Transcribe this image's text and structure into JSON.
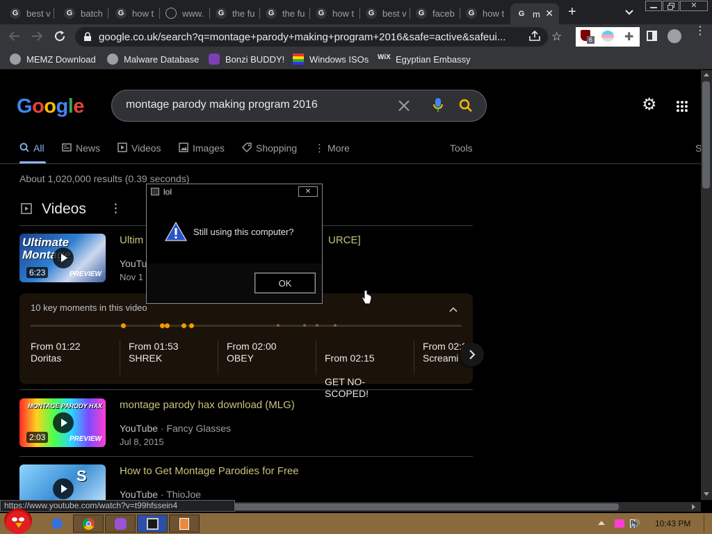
{
  "browser": {
    "tabs": [
      {
        "title": "best v"
      },
      {
        "title": "batch"
      },
      {
        "title": "how t"
      },
      {
        "title": "www."
      },
      {
        "title": "the fu"
      },
      {
        "title": "the fu"
      },
      {
        "title": "how t"
      },
      {
        "title": "best v"
      },
      {
        "title": "faceb"
      },
      {
        "title": "how t"
      },
      {
        "title": "m"
      }
    ],
    "url": "google.co.uk/search?q=montage+parody+making+program+2016&safe=active&safeui...",
    "extension_badge": "6",
    "bookmarks": [
      {
        "label": "MEMZ Download"
      },
      {
        "label": "Malware Database"
      },
      {
        "label": "Bonzi BUDDY!"
      },
      {
        "label": "Windows ISOs"
      },
      {
        "label": "Egyptian Embassy"
      }
    ]
  },
  "search": {
    "logo": "Google",
    "query": "montage parody making program 2016",
    "nav_tabs": [
      {
        "label": "All",
        "icon": "search-icon"
      },
      {
        "label": "News",
        "icon": "news-icon"
      },
      {
        "label": "Videos",
        "icon": "video-icon"
      },
      {
        "label": "Images",
        "icon": "image-icon"
      },
      {
        "label": "Shopping",
        "icon": "tag-icon"
      },
      {
        "label": "More",
        "icon": "more-vert-icon"
      }
    ],
    "tools_label": "Tools",
    "clipped_label": "S",
    "stats": "About 1,020,000 results (0.39 seconds)",
    "videos_heading": "Videos"
  },
  "videos": [
    {
      "title": "Ultim",
      "title_tail": "URCE]",
      "source": "YouTu",
      "date": "Nov 1",
      "duration": "6:23",
      "preview": "PREVIEW",
      "thumb_text": "Ultimate Montage"
    },
    {
      "title": "montage parody hax download (MLG)",
      "source": "YouTube",
      "channel": "Fancy Glasses",
      "date": "Jul 8, 2015",
      "duration": "2:03",
      "preview": "PREVIEW",
      "thumb_text": "MONTAGE PARODY HAX"
    },
    {
      "title": "How to Get Montage Parodies for Free",
      "source": "YouTube",
      "channel": "ThioJoe",
      "thumb_text": "S"
    }
  ],
  "key_moments": {
    "header": "10 key moments in this video",
    "items": [
      {
        "time": "From 01:22",
        "label": "Doritas"
      },
      {
        "time": "From 01:53",
        "label": "SHREK"
      },
      {
        "time": "From 02:00",
        "label": "OBEY"
      },
      {
        "time": "From 02:15",
        "label": "GET NO-\nSCOPED!"
      },
      {
        "time": "From 02:2",
        "label": "Screami"
      }
    ]
  },
  "dialog": {
    "title": "lol",
    "message": "Still using this computer?",
    "ok_label": "OK"
  },
  "status_url": "https://www.youtube.com/watch?v=t99hfssein4",
  "taskbar": {
    "clock": "10:43 PM"
  },
  "colors": {
    "accent_link": "#c9c37c",
    "timeline_dot": "#f29900",
    "background": "#000000"
  }
}
